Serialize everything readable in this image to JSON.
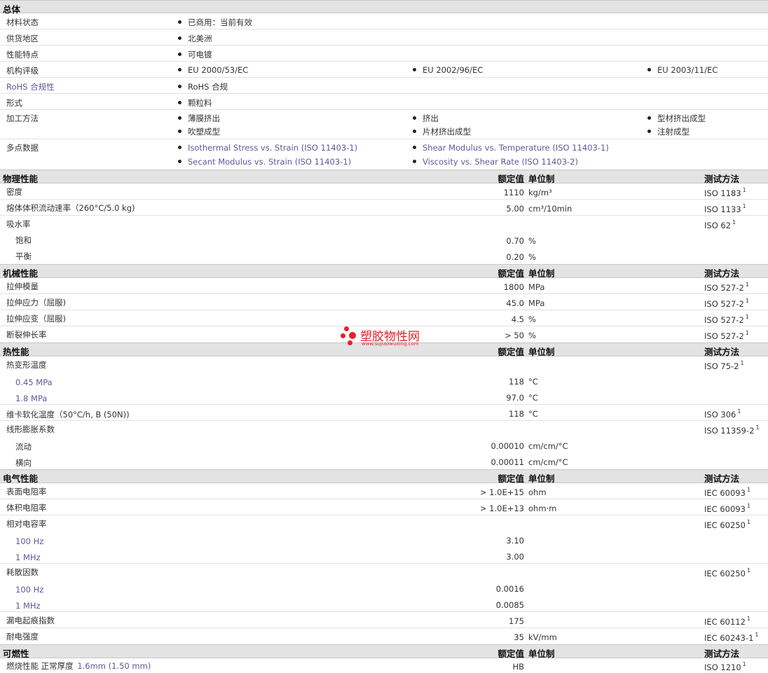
{
  "sections": {
    "general": "总体",
    "physical": "物理性能",
    "mechanical": "机械性能",
    "thermal": "热性能",
    "electrical": "电气性能",
    "flammability": "可燃性"
  },
  "headers": {
    "value": "额定值",
    "unit": "单位制",
    "method": "测试方法"
  },
  "general": {
    "material_status": {
      "label": "材料状态",
      "value": "已商用：当前有效"
    },
    "availability": {
      "label": "供货地区",
      "value": "北美洲"
    },
    "features": {
      "label": "性能特点",
      "value": "可电镀"
    },
    "agency": {
      "label": "机构评级",
      "values": [
        "EU 2000/53/EC",
        "EU 2002/96/EC",
        "EU 2003/11/EC"
      ]
    },
    "rohs": {
      "label": "RoHS 合规性",
      "value": "RoHS 合规"
    },
    "form": {
      "label": "形式",
      "value": "颗粒料"
    },
    "processing": {
      "label": "加工方法",
      "values": [
        "薄膜挤出",
        "挤出",
        "型材挤出成型",
        "吹塑成型",
        "片材挤出成型",
        "注射成型"
      ]
    },
    "multipoint": {
      "label": "多点数据",
      "values": [
        "Isothermal Stress vs. Strain (ISO 11403-1)",
        "Shear Modulus vs. Temperature (ISO 11403-1)",
        "Secant Modulus vs. Strain (ISO 11403-1)",
        "Viscosity vs. Shear Rate (ISO 11403-2)"
      ]
    }
  },
  "physical": [
    {
      "label": "密度",
      "value": "1110",
      "unit": "kg/m³",
      "method": "ISO 1183",
      "sup": "1"
    },
    {
      "label": "熔体体积流动速率（260°C/5.0 kg)",
      "value": "5.00",
      "unit": "cm³/10min",
      "method": "ISO 1133",
      "sup": "1"
    },
    {
      "label": "吸水率",
      "value": "",
      "unit": "",
      "method": "ISO 62",
      "sup": "1"
    },
    {
      "label": "饱和",
      "value": "0.70",
      "unit": "%",
      "method": "",
      "sup": ""
    },
    {
      "label": "平衡",
      "value": "0.20",
      "unit": "%",
      "method": "",
      "sup": ""
    }
  ],
  "mechanical": [
    {
      "label": "拉伸模量",
      "value": "1800",
      "unit": "MPa",
      "method": "ISO 527-2",
      "sup": "1"
    },
    {
      "label": "拉伸应力（屈服)",
      "value": "45.0",
      "unit": "MPa",
      "method": "ISO 527-2",
      "sup": "1"
    },
    {
      "label": "拉伸应变（屈服)",
      "value": "4.5",
      "unit": "%",
      "method": "ISO 527-2",
      "sup": "1"
    },
    {
      "label": "断裂伸长率",
      "value": "> 50",
      "unit": "%",
      "method": "ISO 527-2",
      "sup": "1"
    }
  ],
  "thermal": [
    {
      "label": "热变形温度",
      "value": "",
      "unit": "",
      "method": "ISO 75-2",
      "sup": "1"
    },
    {
      "label": "0.45 MPa",
      "value": "118",
      "unit": "°C",
      "method": "",
      "sup": ""
    },
    {
      "label": "1.8 MPa",
      "value": "97.0",
      "unit": "°C",
      "method": "",
      "sup": ""
    },
    {
      "label": "维卡软化温度（50°C/h, B (50N))",
      "value": "118",
      "unit": "°C",
      "method": "ISO 306",
      "sup": "1"
    },
    {
      "label": "线形膨胀系数",
      "value": "",
      "unit": "",
      "method": "ISO 11359-2",
      "sup": "1"
    },
    {
      "label": "流动",
      "value": "0.00010",
      "unit": "cm/cm/°C",
      "method": "",
      "sup": ""
    },
    {
      "label": "横向",
      "value": "0.00011",
      "unit": "cm/cm/°C",
      "method": "",
      "sup": ""
    }
  ],
  "electrical": [
    {
      "label": "表面电阻率",
      "value": "> 1.0E+15",
      "unit": "ohm",
      "method": "IEC 60093",
      "sup": "1"
    },
    {
      "label": "体积电阻率",
      "value": "> 1.0E+13",
      "unit": "ohm·m",
      "method": "IEC 60093",
      "sup": "1"
    },
    {
      "label": "相对电容率",
      "value": "",
      "unit": "",
      "method": "IEC 60250",
      "sup": "1"
    },
    {
      "label": "100 Hz",
      "value": "3.10",
      "unit": "",
      "method": "",
      "sup": ""
    },
    {
      "label": "1 MHz",
      "value": "3.00",
      "unit": "",
      "method": "",
      "sup": ""
    },
    {
      "label": "耗散因数",
      "value": "",
      "unit": "",
      "method": "IEC 60250",
      "sup": "1"
    },
    {
      "label": "100 Hz",
      "value": "0.0016",
      "unit": "",
      "method": "",
      "sup": ""
    },
    {
      "label": "1 MHz",
      "value": "0.0085",
      "unit": "",
      "method": "",
      "sup": ""
    },
    {
      "label": "漏电起痕指数",
      "value": "175",
      "unit": "",
      "method": "IEC 60112",
      "sup": "1"
    },
    {
      "label": "耐电强度",
      "value": "35",
      "unit": "kV/mm",
      "method": "IEC 60243-1",
      "sup": "1"
    }
  ],
  "flammability": {
    "label": "燃烧性能 正常厚度",
    "thickness": "1.6mm (1.50 mm)",
    "value": "HB",
    "unit": "",
    "method": "ISO 1210",
    "sup": "1"
  },
  "watermark": {
    "name": "塑胶物性网",
    "url": "www.sujiaowuxing.com",
    "color": "#e8202a"
  }
}
